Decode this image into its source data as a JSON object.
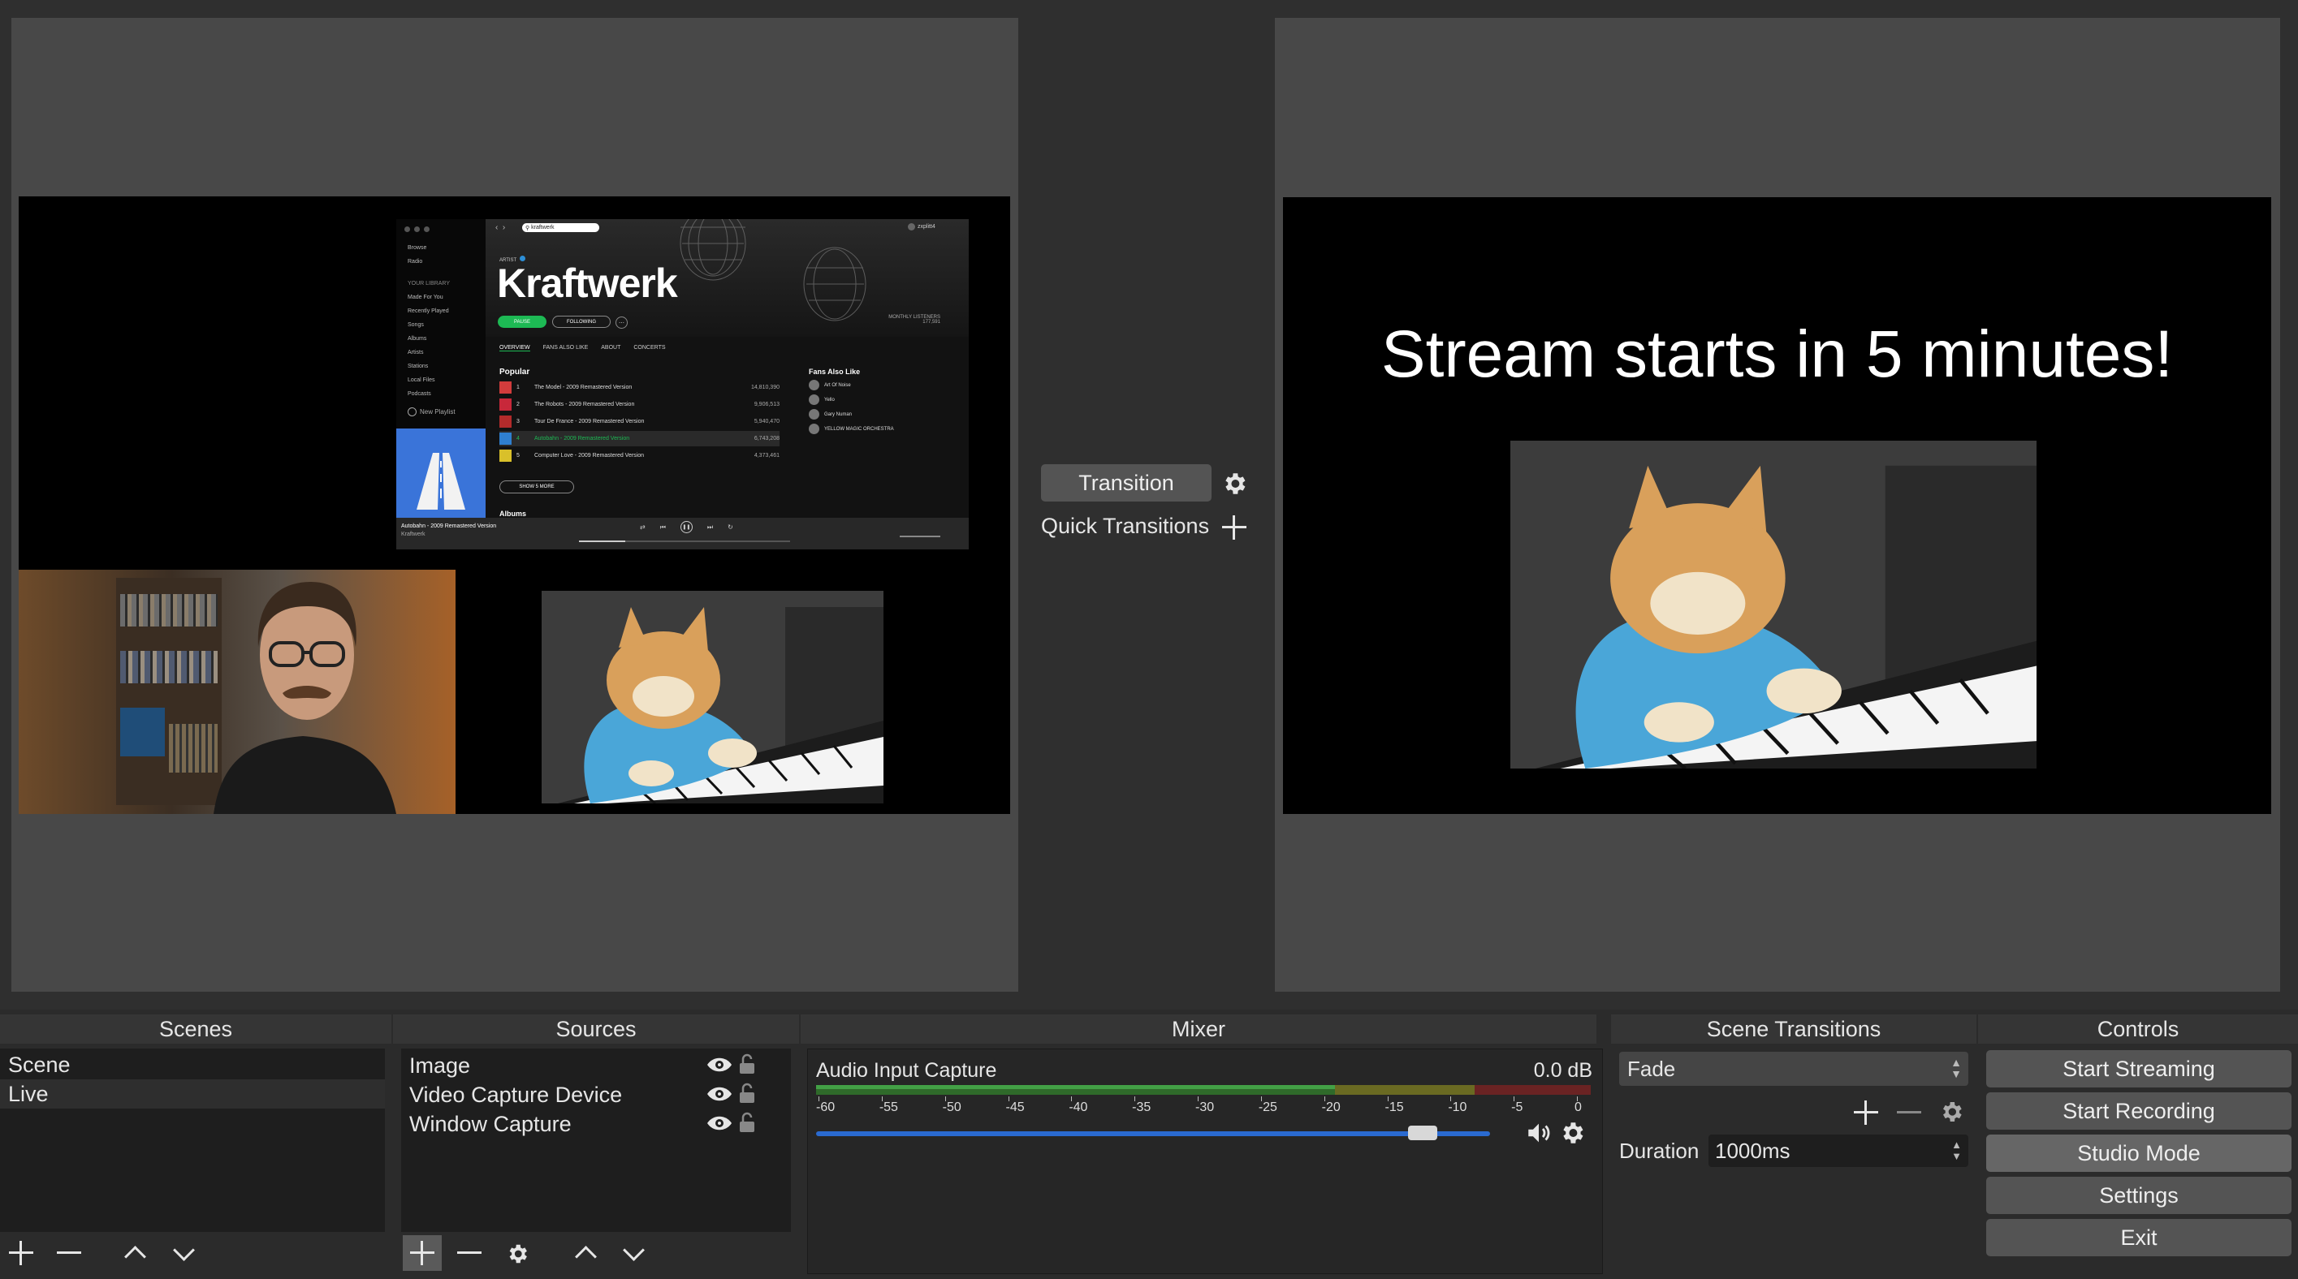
{
  "preview": {
    "spotify": {
      "search_text": "kraftwerk",
      "artist_badge": "ARTIST",
      "artist_name": "Kraftwerk",
      "pause_label": "PAUSE",
      "following_label": "FOLLOWING",
      "tabs": [
        "OVERVIEW",
        "FANS ALSO LIKE",
        "ABOUT",
        "CONCERTS"
      ],
      "sidebar": [
        "Browse",
        "Radio",
        "YOUR LIBRARY",
        "Made For You",
        "Recently Played",
        "Songs",
        "Albums",
        "Artists",
        "Stations",
        "Local Files",
        "Podcasts"
      ],
      "new_playlist": "New Playlist",
      "popular_heading": "Popular",
      "tracks": [
        {
          "num": "1",
          "title": "The Model - 2009 Remastered Version",
          "plays": "14,810,390",
          "color": "#d23c3c"
        },
        {
          "num": "2",
          "title": "The Robots - 2009 Remastered Version",
          "plays": "9,906,513",
          "color": "#c8283a"
        },
        {
          "num": "3",
          "title": "Tour De France - 2009 Remastered Version",
          "plays": "5,940,470",
          "color": "#b32b2b"
        },
        {
          "num": "4",
          "title": "Autobahn - 2009 Remastered Version",
          "plays": "6,743,208",
          "color": "#2f7fcf"
        },
        {
          "num": "5",
          "title": "Computer Love - 2009 Remastered Version",
          "plays": "4,373,461",
          "color": "#d9c02a"
        }
      ],
      "show_more": "SHOW 5 MORE",
      "albums_heading": "Albums",
      "fans_heading": "Fans Also Like",
      "fans": [
        "Art Of Noise",
        "Yello",
        "Gary Numan",
        "YELLOW MAGIC ORCHESTRA"
      ],
      "now_playing_title": "Autobahn - 2009 Remastered Version",
      "now_playing_artist": "Kraftwerk",
      "user": "zxplitt4",
      "monthly_listeners": "MONTHLY LISTENERS",
      "listener_count": "177,591"
    }
  },
  "transition": {
    "button_label": "Transition",
    "quick_transitions_label": "Quick Transitions"
  },
  "program": {
    "headline": "Stream starts in 5 minutes!"
  },
  "docks": {
    "scenes": {
      "title": "Scenes",
      "items": [
        "Scene",
        "Live"
      ]
    },
    "sources": {
      "title": "Sources",
      "items": [
        "Image",
        "Video Capture Device",
        "Window Capture"
      ]
    },
    "mixer": {
      "title": "Mixer",
      "channel": "Audio Input Capture",
      "level": "0.0 dB",
      "ticks": [
        "-60",
        "-55",
        "-50",
        "-45",
        "-40",
        "-35",
        "-30",
        "-25",
        "-20",
        "-15",
        "-10",
        "-5",
        "0"
      ],
      "volume_fraction": 0.9
    },
    "transitions": {
      "title": "Scene Transitions",
      "selected": "Fade",
      "duration_label": "Duration",
      "duration_value": "1000ms"
    },
    "controls": {
      "title": "Controls",
      "buttons": [
        "Start Streaming",
        "Start Recording",
        "Studio Mode",
        "Settings",
        "Exit"
      ]
    }
  },
  "colors": {
    "background": "#2f2f2f",
    "pane": "#484848",
    "list": "#1e1e1e",
    "accent_blue": "#3a74d9",
    "spotify_green": "#1db954"
  }
}
